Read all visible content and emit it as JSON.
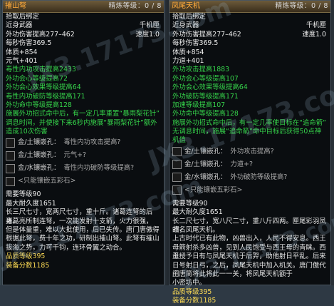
{
  "left": {
    "name": "摧山弩",
    "refine": "精炼等级：0 / 8",
    "bind": "拾取后绑定",
    "weapon_type": "近身武器",
    "category": "千机匣",
    "damage": "外功伤害提高277–462",
    "speed": "速度1.0",
    "dps": "每秒伤害369.5",
    "stat1": "体质+854",
    "stat2": "元气+401",
    "greens": [
      "毒性内功攻击提高2433",
      "外功会心等级提高72",
      "外功会心效果等级提高64",
      "毒性内功破防等级提高171",
      "外功命中等级提高128"
    ],
    "effect_text": "施展外功招式命中后，有一定几率重置“暴雨梨花针”调息时间，并使接下来6秒内施展“暴雨梨花针”额外造成10次伤害",
    "effect_lines": [
      "施展外功招式命中后，有一定几率重置“暴雨梨花针”",
      "调息时间，并使接下来6秒内施展“暴雨梨花针”额外",
      "造成10次伤害"
    ],
    "slots": [
      {
        "label": "金/土镶嵌孔：",
        "effect": "毒性内功攻击提高?"
      },
      {
        "label": "金/土镶嵌孔：",
        "effect": "元气+?"
      },
      {
        "label": "金/水镶嵌孔：",
        "effect": "毒性内功破防等级提高?"
      }
    ],
    "colored_socket": "<只能镶嵌五彩石>",
    "req_level": "需要等级90",
    "durability": "最大耐久度1651",
    "description": "长三尺七寸，宽两尺七寸，重十斤。诸葛连弩的后身。诸葛亮所制连弩，一次能发射十支箭，火力很强，但是体量重，难以大批使用，后已失传。唐门唐傲得根据此弩，费十年之功，研制出摧山弩。此弩有摧山拔海之势，力可千钧，连环骨翼之动合。",
    "desc_lines": [
      "长三尺七寸，宽两尺七寸，重十斤。诸葛连弩的后身。",
      "诸葛亮所制连弩，一次能发射十支箭，火力很强，",
      "但是体量重，难以大批使用，后已失传。唐门唐傲得",
      "根据此弩，费十年之功，研制出摧山弩。此弩有摧山",
      "拔海之势，力可千钧，连环骨翼之动合。"
    ],
    "quality": "品质等级395",
    "score": "装备分数1185"
  },
  "right": {
    "name": "凤尾天机",
    "refine": "精炼等级：0 / 8",
    "bind": "拾取后绑定",
    "weapon_type": "近身武器",
    "category": "千机匣",
    "damage": "外功伤害提高277–462",
    "speed": "速度1.0",
    "dps": "每秒伤害369.5",
    "stat1": "体质+854",
    "stat2": "力道+401",
    "greens": [
      "外功攻击提高1883",
      "外功会心等级提高107",
      "外功会心效果等级提高64",
      "外功破防等级提高171",
      "加速等级提高107",
      "外功命中等级提高128"
    ],
    "effect_text": "施展外功招式命中后，有一定几率使目标在“追命箭”无调息时间，施展“追命箭”命中目标后获得50点神机值",
    "effect_lines": [
      "施展外功招式命中后，有一定几率使目标在“追命箭”",
      "无调息时间，施展“追命箭”命中目标后获得50点神",
      "机值"
    ],
    "slots": [
      {
        "label": "金/土镶嵌孔：",
        "effect": "外功攻击提高?"
      },
      {
        "label": "金/土镶嵌孔：",
        "effect": "力道+?"
      },
      {
        "label": "金/水镶嵌孔：",
        "effect": "外功破防等级提高?"
      }
    ],
    "colored_socket": "<只能镶嵌五彩石>",
    "req_level": "需要等级90",
    "durability": "最大耐久度1651",
    "description": "长二尺七寸，宽八尺二寸，重八斤四两。匣尾彩羽凤翎，故名凤尾天机。上古时代已有此物，凶兽出入，人民不得安息。西王母箭射杀多凶兽，见到人民饱受与西王母的青睐。西王母授予日有与凤尾天机于后，因他们平原乘。后来以天机箭射护。日与射日神弓。日之后弓，之后，唐门在凤尾天机中加入机关，唐门傲代门主唐简将此将此一一关，将凤尾天机额于小密坊中。",
    "desc_lines": [
      "长二尺七寸，宽八尺二寸，重八斤四两。匣尾彩羽凤翎，",
      "故名凤尾天机。",
      "上古时代已有此物，凶兽出入，人民不得安息。西王",
      "母箭射杀多凶兽，见到人民饱受与西王母的青睐。西王",
      "母授予日有与凤尾天机于后羿，助他射日平乱。后来",
      "日号射日弓，之后，凤尾天机中加入机关。唐门傲代门",
      "主唐简将此将此一一关，将凤尾天机额于",
      "小密坊中。"
    ],
    "quality": "品质等级395",
    "score": "装备分数1185"
  },
  "watermark": "JX3.17173.com",
  "colors": {
    "gold": "#ffaa3a",
    "green": "#35d24a",
    "white": "#eeeeee",
    "yellow": "#f7c84a"
  }
}
